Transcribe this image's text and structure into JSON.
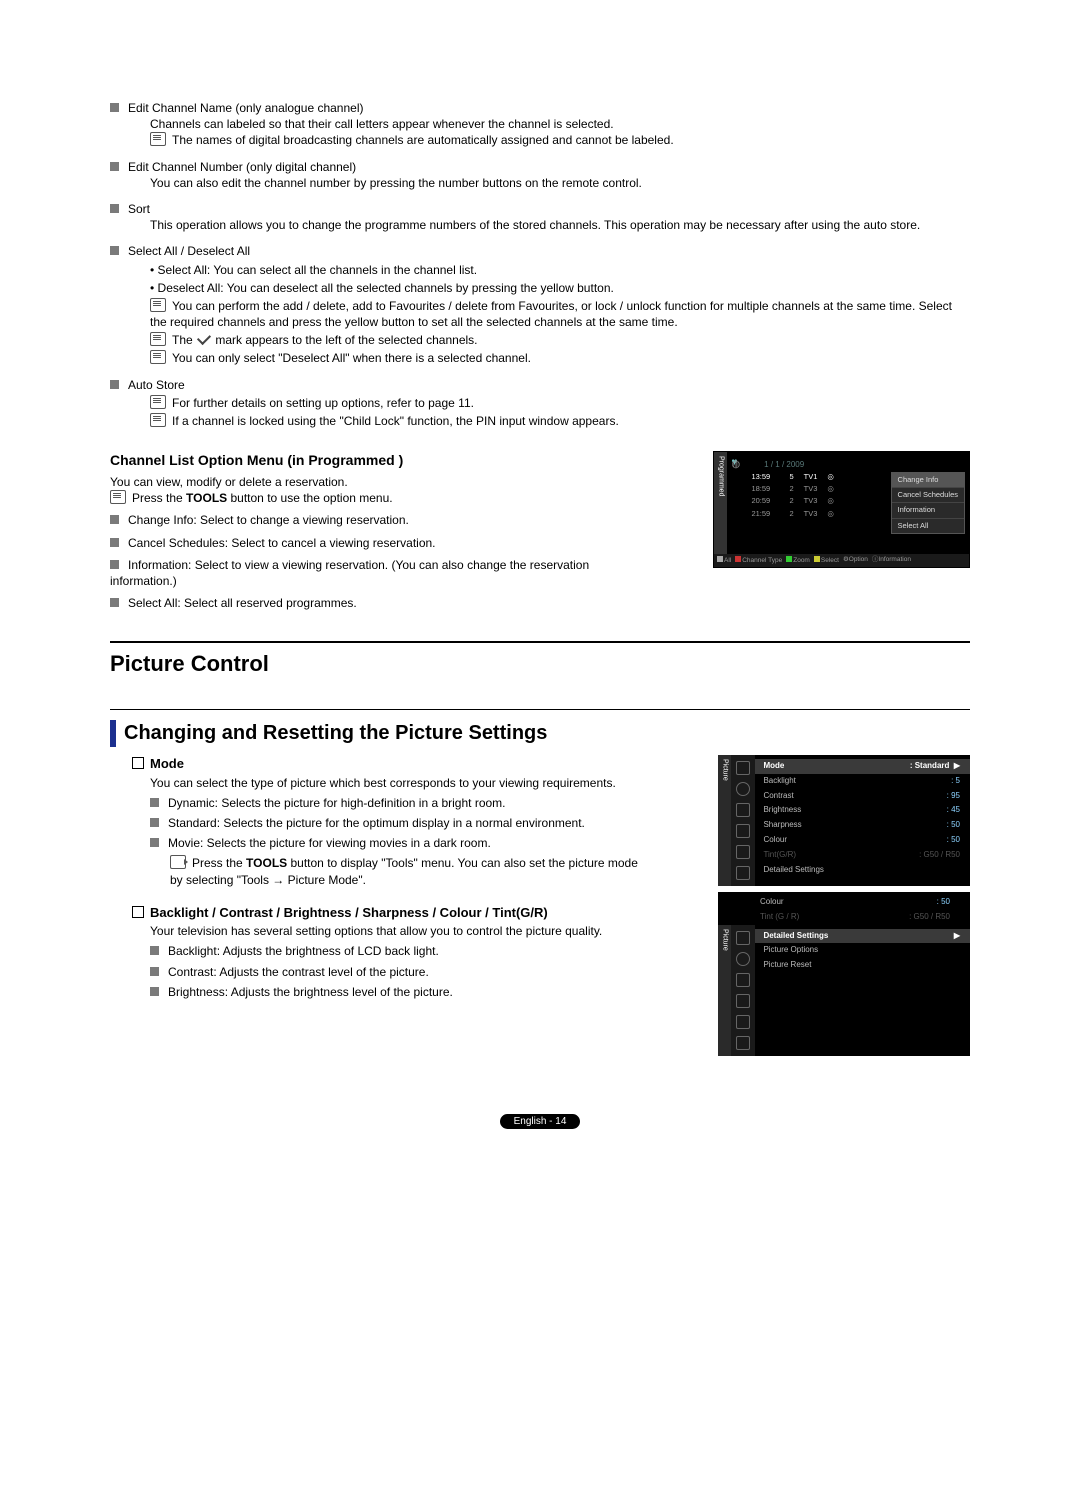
{
  "items": {
    "edit_name": {
      "title": "Edit Channel Name (only analogue channel)",
      "desc": "Channels can labeled so that their call letters appear whenever the channel is selected.",
      "note": "The names of digital broadcasting channels are automatically assigned and cannot be labeled."
    },
    "edit_num": {
      "title": "Edit Channel Number (only digital channel)",
      "desc": "You can also edit the channel number by pressing the number buttons on the remote control."
    },
    "sort": {
      "title": "Sort",
      "desc": "This operation allows you to change the programme numbers of the stored channels. This operation may be necessary after using the auto store."
    },
    "select": {
      "title": "Select All / Deselect All",
      "b1": "Select All: You can select all the channels in the channel list.",
      "b2": "Deselect All: You can deselect all the selected channels by pressing the yellow button.",
      "n1": "You can perform the add / delete, add to Favourites / delete from Favourites, or lock / unlock function for multiple channels at the same time. Select the required channels and press the yellow button to set all the selected channels at the same time.",
      "n2a": "The ",
      "n2b": " mark appears to the left of the selected channels.",
      "n3": "You can only select \"Deselect All\" when there is a selected channel."
    },
    "auto": {
      "title": "Auto Store",
      "n1": "For further details on setting up options, refer to page 11.",
      "n2": "If a channel is locked using the \"Child Lock\" function, the PIN input window appears."
    }
  },
  "prog_section": {
    "title": "Channel List Option Menu (in Programmed )",
    "intro": "You can view, modify or delete a reservation.",
    "note": "Press the TOOLS button to use the option menu.",
    "i1": "Change Info: Select to change a viewing reservation.",
    "i2": "Cancel Schedules: Select to cancel a viewing reservation.",
    "i3": "Information: Select to view a viewing reservation. (You can also change the reservation information.)",
    "i4": "Select All: Select all reserved programmes."
  },
  "sched": {
    "tab": "Programmed",
    "date": "1 / 1 / 2009",
    "rows": [
      {
        "t": "13:59",
        "n": "5",
        "c": "TV1",
        "hi": true
      },
      {
        "t": "18:59",
        "n": "2",
        "c": "TV3",
        "hi": false
      },
      {
        "t": "20:59",
        "n": "2",
        "c": "TV3",
        "hi": false
      },
      {
        "t": "21:59",
        "n": "2",
        "c": "TV3",
        "hi": false
      }
    ],
    "popup": [
      "Change Info",
      "Cancel Schedules",
      "Information",
      "Select All"
    ],
    "footer": {
      "all": "All",
      "ct": "Channel Type",
      "zoom": "Zoom",
      "sel": "Select",
      "opt": "Option",
      "info": "Information"
    }
  },
  "picture": {
    "section": "Picture Control",
    "heading": "Changing and Resetting the Picture Settings",
    "mode": {
      "title": "Mode",
      "intro": "You can select the type of picture which best corresponds to your viewing requirements.",
      "i1": "Dynamic: Selects the picture for high-definition in a bright room.",
      "i2": "Standard: Selects the picture for the optimum display in a normal environment.",
      "i3": "Movie: Selects the picture for viewing movies in a dark room.",
      "t1": "Press the TOOLS button to display \"Tools\" menu. You can also set the picture mode by selecting \"Tools → Picture Mode\"."
    },
    "bcb": {
      "title": "Backlight / Contrast / Brightness / Sharpness / Colour / Tint(G/R)",
      "intro": "Your television has several setting options that allow you to control the picture quality.",
      "i1": "Backlight: Adjusts the brightness of LCD back light.",
      "i2": "Contrast: Adjusts the contrast level of the picture.",
      "i3": "Brightness: Adjusts the brightness level of the picture."
    }
  },
  "menu1": {
    "tab": "Picture",
    "rows": [
      {
        "l": "Mode",
        "r": ": Standard",
        "hi": true,
        "arrow": true
      },
      {
        "l": "Backlight",
        "r": ": 5"
      },
      {
        "l": "Contrast",
        "r": ": 95"
      },
      {
        "l": "Brightness",
        "r": ": 45"
      },
      {
        "l": "Sharpness",
        "r": ": 50"
      },
      {
        "l": "Colour",
        "r": ": 50"
      },
      {
        "l": "Tint(G/R)",
        "r": ": G50 / R50",
        "dim": true
      },
      {
        "l": "Detailed Settings",
        "r": ""
      }
    ]
  },
  "menu2": {
    "tab": "Picture",
    "rows": [
      {
        "l": "Colour",
        "r": ": 50"
      },
      {
        "l": "Tint (G / R)",
        "r": ": G50 / R50",
        "dim": true
      },
      {
        "l": "Detailed Settings",
        "r": "",
        "hi": true,
        "arrow": true
      },
      {
        "l": "Picture Options",
        "r": ""
      },
      {
        "l": "Picture Reset",
        "r": ""
      }
    ]
  },
  "pagefoot": "English - 14"
}
